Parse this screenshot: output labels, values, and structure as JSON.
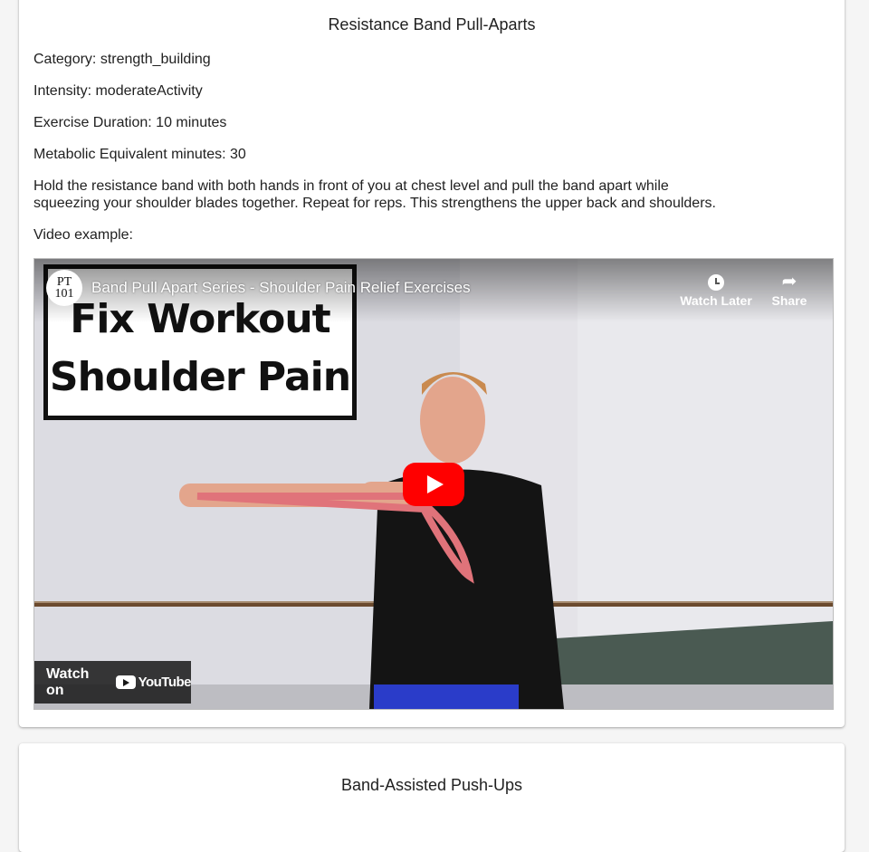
{
  "cards": [
    {
      "title": "Resistance Band Pull-Aparts",
      "category": "Category: strength_building",
      "intensity": "Intensity: moderateActivity",
      "duration": "Exercise Duration: 10 minutes",
      "met_minutes": "Metabolic Equivalent minutes: 30",
      "description": "Hold the resistance band with both hands in front of you at chest level and pull the band apart while squeezing your shoulder blades together. Repeat for reps. This strengthens the upper back and shoulders.",
      "video_label": "Video example:",
      "video": {
        "title": "Band Pull Apart Series - Shoulder Pain Relief Exercises",
        "channel_logo_text": "PT 101",
        "thumbnail_line1": "Fix Workout",
        "thumbnail_line2": "Shoulder Pain",
        "watch_later_label": "Watch Later",
        "share_label": "Share",
        "watch_on_label": "Watch on",
        "youtube_label": "YouTube"
      }
    },
    {
      "title": "Band-Assisted Push-Ups"
    }
  ],
  "colors": {
    "play_button": "#ff0000",
    "card_background": "#ffffff",
    "page_background": "#f5f5f5"
  },
  "icons": {
    "watch_later": "clock-icon",
    "share": "share-arrow-icon",
    "play": "play-icon",
    "youtube": "youtube-logo-icon"
  }
}
